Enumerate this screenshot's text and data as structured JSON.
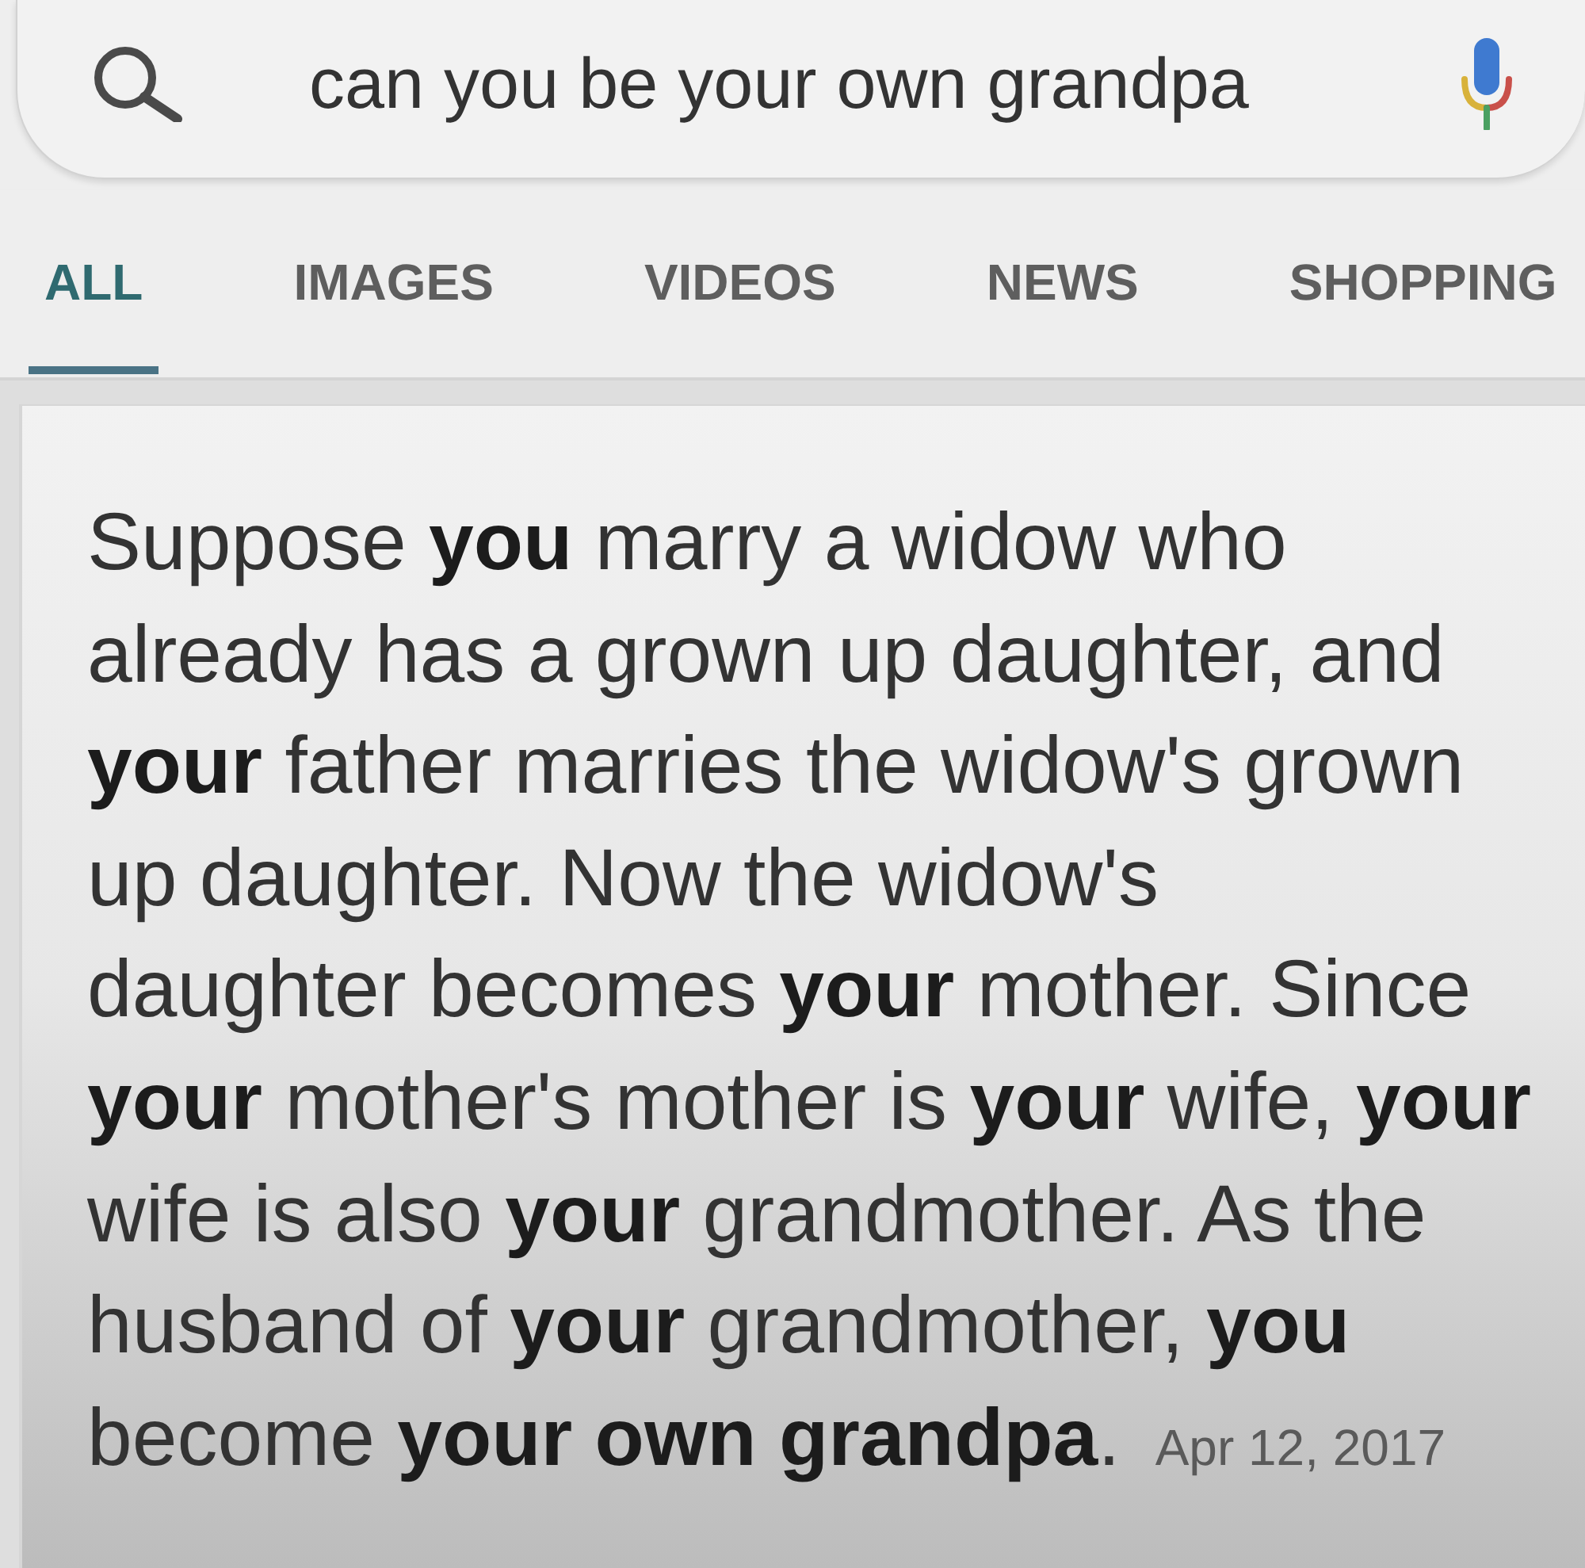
{
  "search": {
    "query": "can you be your own grandpa"
  },
  "tabs": [
    {
      "label": "ALL",
      "selected": true
    },
    {
      "label": "IMAGES",
      "selected": false
    },
    {
      "label": "VIDEOS",
      "selected": false
    },
    {
      "label": "NEWS",
      "selected": false
    },
    {
      "label": "SHOPPING",
      "selected": false
    }
  ],
  "result": {
    "snippet": "Suppose **you** marry a widow who\nalready has a grown up daughter, and\n**your** father marries the widow's grown\nup daughter. Now the widow's\ndaughter becomes **your** mother. Since\n**your** mother's mother is **your** wife, **your**\nwife is also **your** grandmother. As the\nhusband of **your** grandmother, **you**\nbecome **your own grandpa**.",
    "date": "Apr 12, 2017"
  }
}
